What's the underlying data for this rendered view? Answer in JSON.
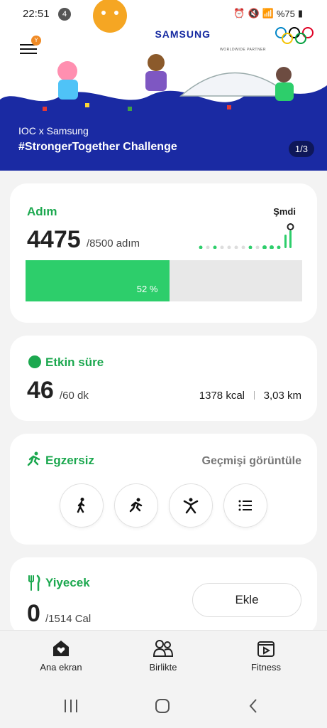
{
  "status": {
    "time": "22:51",
    "notification_count": "4",
    "battery": "%75"
  },
  "banner": {
    "brand": "SAMSUNG",
    "partner": "WORLDWIDE PARTNER",
    "menu_badge": "Y",
    "subtitle": "IOC x Samsung",
    "title": "#StrongerTogether Challenge",
    "page": "1/3"
  },
  "steps": {
    "title": "Adım",
    "value": "4475",
    "goal": "/8500 adım",
    "now_label": "Şmdi",
    "progress_percent": 52,
    "progress_label": "52 %"
  },
  "active": {
    "title": "Etkin süre",
    "value": "46",
    "goal": "/60 dk",
    "kcal": "1378 kcal",
    "distance": "3,03 km"
  },
  "exercise": {
    "title": "Egzersiz",
    "history_link": "Geçmişi görüntüle",
    "buttons": [
      "walk-icon",
      "run-icon",
      "workout-icon",
      "list-icon"
    ]
  },
  "food": {
    "title": "Yiyecek",
    "value": "0",
    "goal": "/1514 Cal",
    "add_label": "Ekle"
  },
  "nav": {
    "home": "Ana ekran",
    "together": "Birlikte",
    "fitness": "Fitness"
  },
  "colors": {
    "accent": "#1ca84f",
    "progress": "#2dce6b",
    "banner": "#1a2aa3"
  }
}
